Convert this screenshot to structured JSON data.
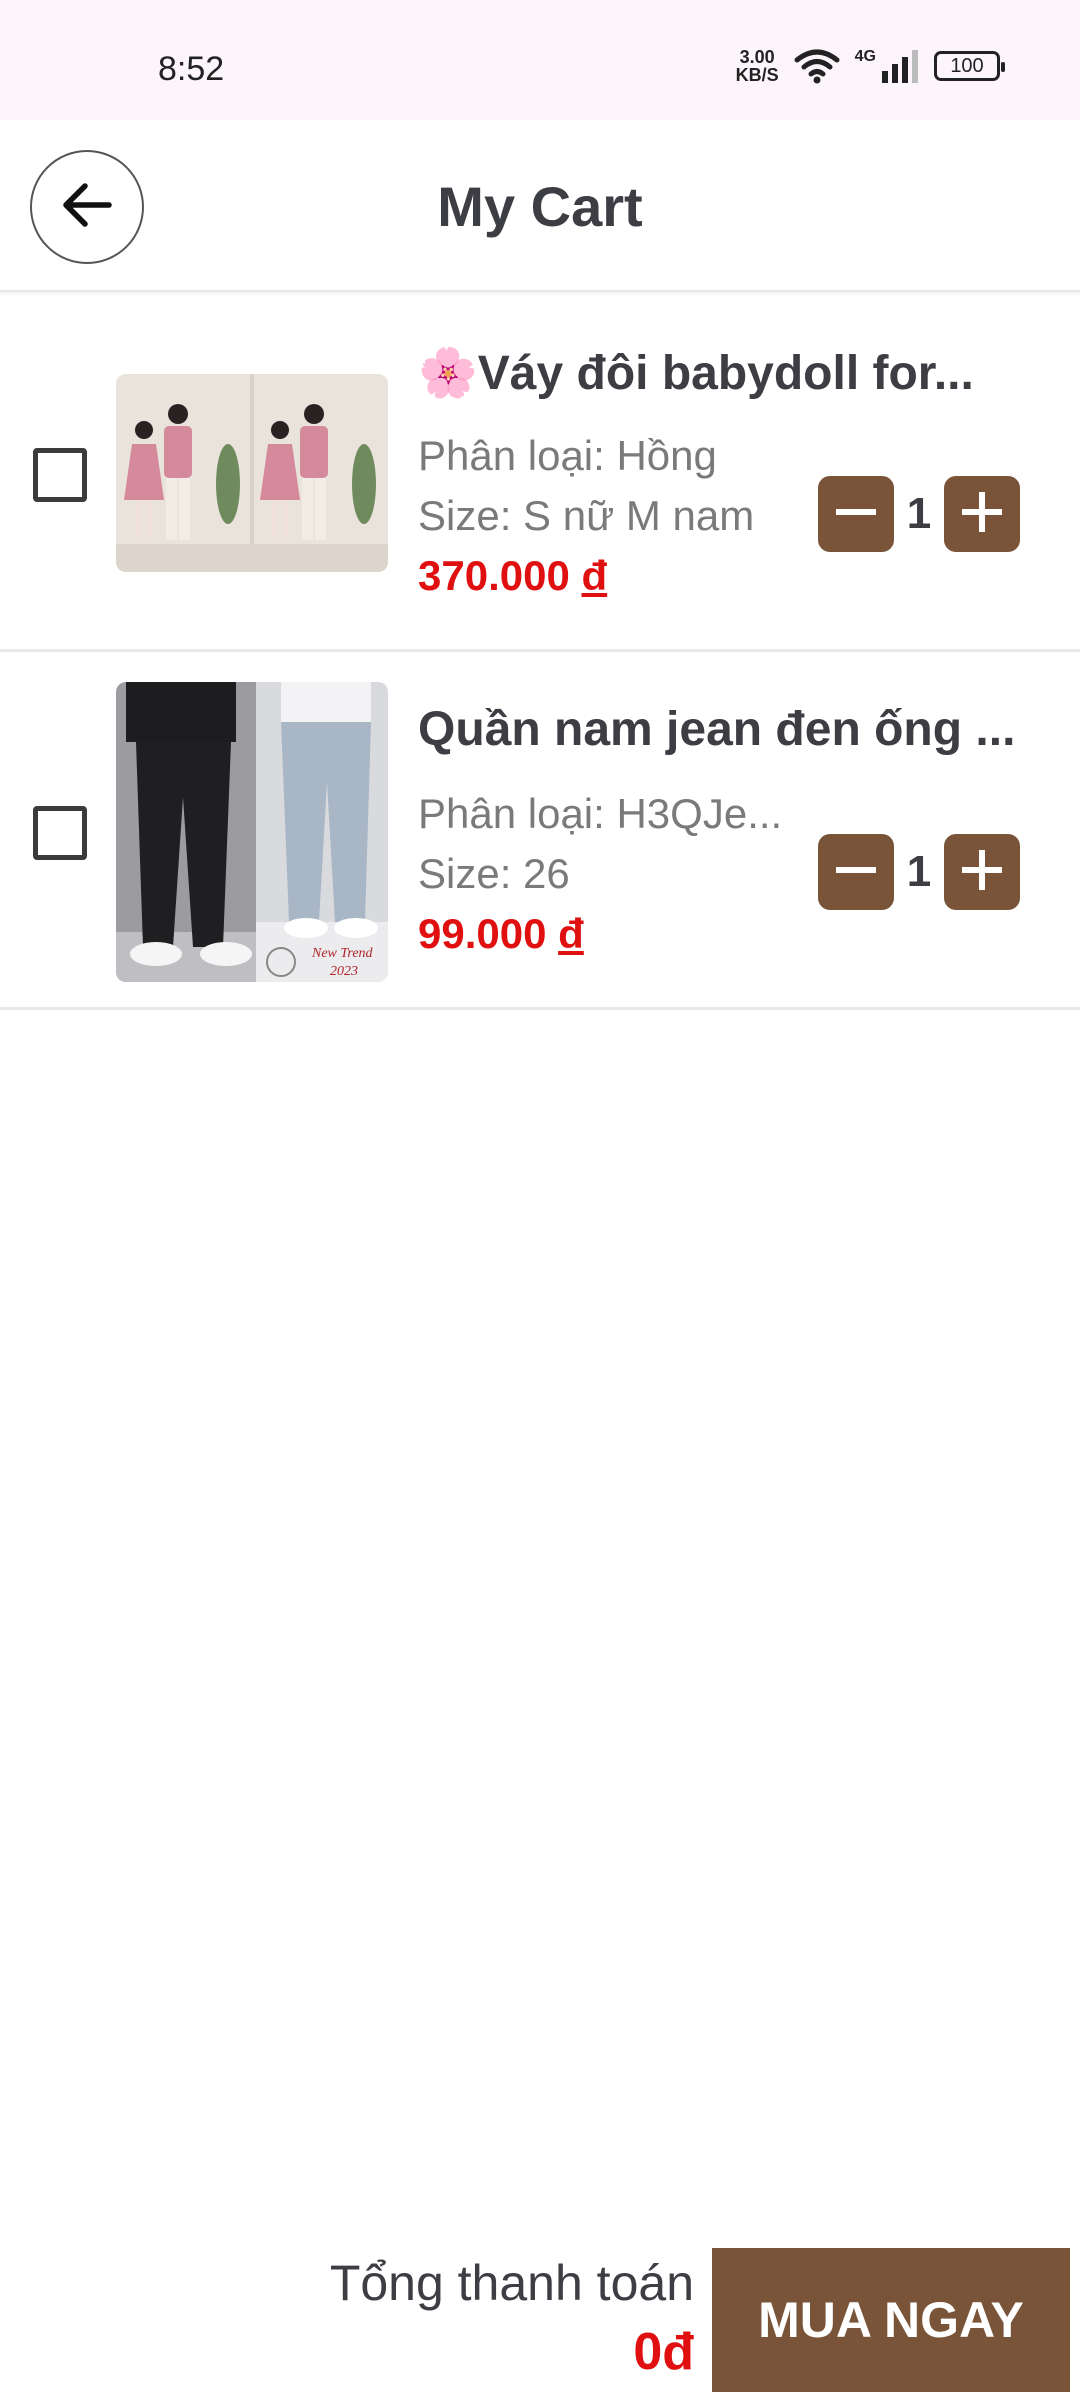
{
  "status_bar": {
    "time": "8:52",
    "net_speed_value": "3.00",
    "net_speed_unit": "KB/S",
    "network_type": "4G",
    "battery": "100"
  },
  "header": {
    "title": "My Cart",
    "back_icon": "arrow-left-icon"
  },
  "cart": {
    "items": [
      {
        "title": "🌸Váy đôi babydoll for...",
        "variant": "Phân loại: Hồng",
        "size": "Size: S nữ  M nam",
        "price": "370.000 ",
        "currency": "đ",
        "quantity": "1"
      },
      {
        "title": "Quần nam jean đen ống ...",
        "variant": "Phân loại: H3QJe...",
        "size": "Size: 26",
        "price": "99.000 ",
        "currency": "đ",
        "quantity": "1",
        "image_caption_line1": "New Trend",
        "image_caption_line2": "2023"
      }
    ]
  },
  "footer": {
    "total_label": "Tổng thanh toán",
    "total_value": "0đ",
    "buy_label": "MUA NGAY"
  },
  "colors": {
    "accent": "#7a5438",
    "price": "#e01010",
    "status_bar_bg": "#fcf5fb"
  }
}
